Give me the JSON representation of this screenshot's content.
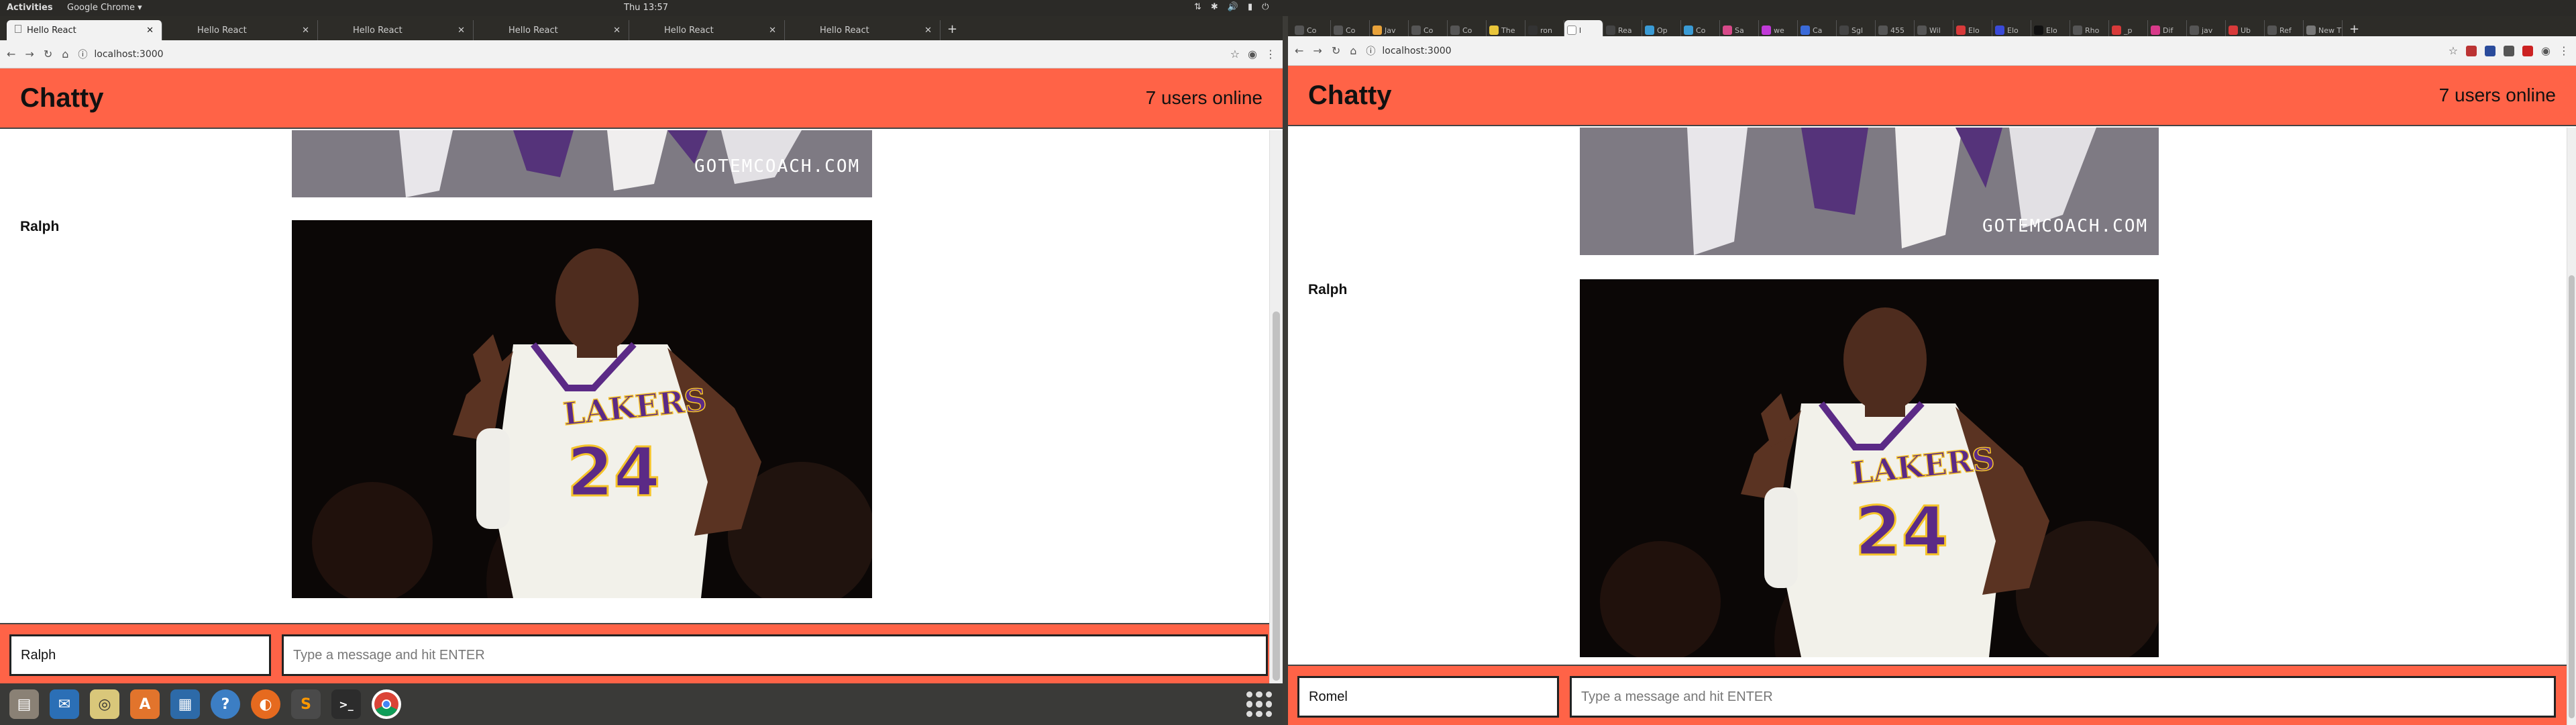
{
  "system": {
    "activities": "Activities",
    "app_menu": "Google Chrome ▾",
    "clock": "Thu 13:57"
  },
  "left_window": {
    "tabs": [
      "Hello React",
      "Hello React",
      "Hello React",
      "Hello React",
      "Hello React",
      "Hello React"
    ],
    "url": "localhost:3000"
  },
  "right_window": {
    "url": "localhost:3000",
    "mini_tabs": [
      "Co",
      "Co",
      "Jav",
      "Co",
      "Co",
      "The",
      "ron",
      "l",
      "Rea",
      "Op",
      "Co",
      "Sa",
      "we",
      "Ca",
      "Sgl",
      "455",
      "Wil",
      "Elo",
      "Elo",
      "Elo",
      "Rho",
      "_p",
      "Dif",
      "jav",
      "Ub",
      "Ref",
      "New T"
    ]
  },
  "chatty_left": {
    "brand": "Chatty",
    "users_online": "7 users online",
    "message_user": "Ralph",
    "watermark": "GOTEMCOACH.COM",
    "jersey_team": "LAKERS",
    "jersey_number": "24",
    "username_value": "Ralph",
    "message_placeholder": "Type a message and hit ENTER"
  },
  "chatty_right": {
    "brand": "Chatty",
    "users_online": "7 users online",
    "message_user": "Ralph",
    "watermark": "GOTEMCOACH.COM",
    "jersey_team": "LAKERS",
    "jersey_number": "24",
    "username_value": "Romel",
    "message_placeholder": "Type a message and hit ENTER"
  },
  "colors": {
    "accent": "#ff6347",
    "page_bg": "#ffffff"
  }
}
